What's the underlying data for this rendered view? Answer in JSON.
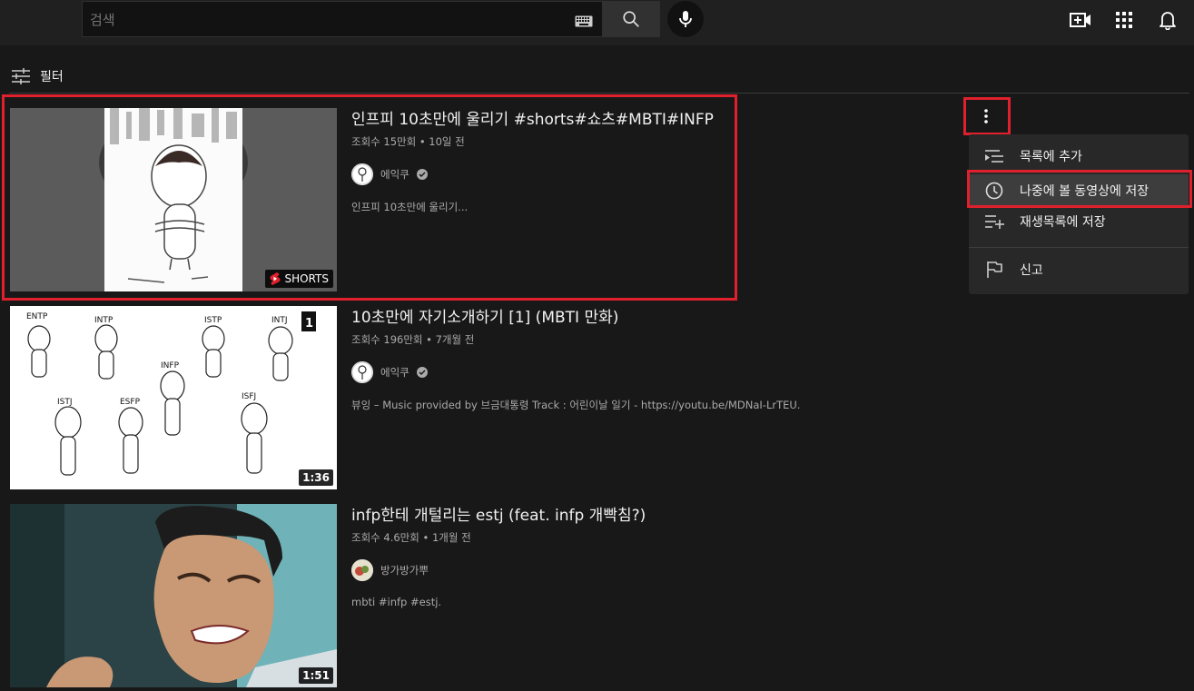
{
  "search": {
    "placeholder": "검색"
  },
  "filter": {
    "label": "필터"
  },
  "results": [
    {
      "title": "인프피 10초만에 울리기 #shorts#쇼츠#MBTI#INFP",
      "stats": "조회수 15만회 • 10일 전",
      "channel": "에익쿠",
      "description": "인프피 10초만에 울리기...",
      "badge": "SHORTS"
    },
    {
      "title": "10초만에 자기소개하기 [1] (MBTI 만화)",
      "stats": "조회수 196만회 • 7개월 전",
      "channel": "에익쿠",
      "description": "뷰잉 – Music provided by 브금대통령 Track : 어린이날 일기 - https://youtu.be/MDNaI-LrTEU.",
      "duration": "1:36",
      "thumb_corner": "1",
      "thumb_labels": [
        "ENTP",
        "INTP",
        "ISTP",
        "INTJ",
        "INFP",
        "ISTJ",
        "ESFP",
        "ISFJ"
      ]
    },
    {
      "title": "infp한테 개털리는 estj (feat. infp 개빡침?)",
      "stats": "조회수 4.6만회 • 1개월 전",
      "channel": "방가방가뿌",
      "description": "mbti #infp #estj.",
      "duration": "1:51"
    }
  ],
  "menu": {
    "items": [
      {
        "label": "목록에 추가",
        "icon": "queue-icon"
      },
      {
        "label": "나중에 볼 동영상에 저장",
        "icon": "clock-icon"
      },
      {
        "label": "재생목록에 저장",
        "icon": "playlist-add-icon"
      },
      {
        "label": "신고",
        "icon": "flag-icon"
      }
    ]
  },
  "colors": {
    "background": "#181818",
    "topbar": "#202020",
    "highlight": "#e0212d",
    "menu": "#282828"
  }
}
